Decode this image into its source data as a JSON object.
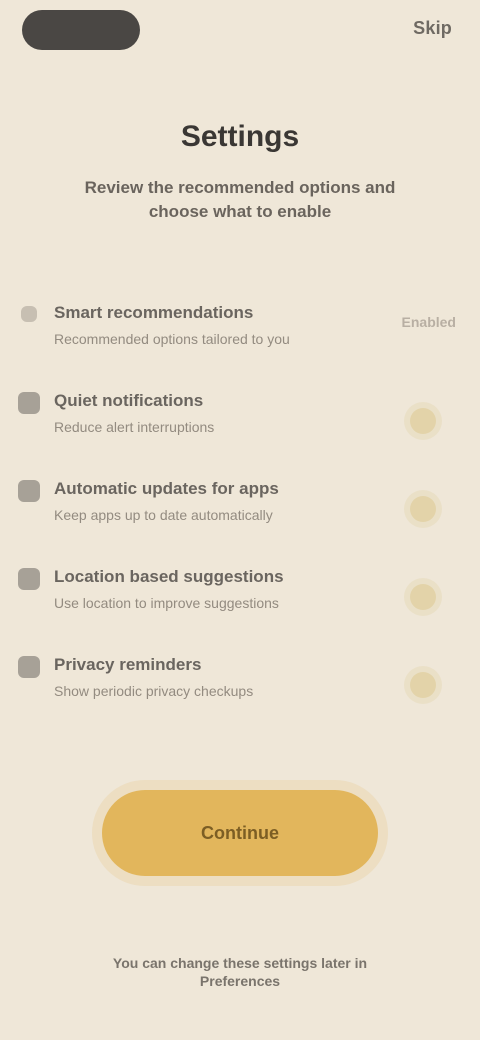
{
  "colors": {
    "background": "#efe7d8",
    "text_primary": "#3a3734",
    "text_secondary": "#6a645d",
    "accent": "#e2b65c",
    "toggle_fill": "#e3d3a9"
  },
  "top_bar": {
    "back_icon": "back-pill-icon",
    "skip_label": "Skip"
  },
  "header": {
    "title": "Settings",
    "subtitle": "Review the recommended options and choose what to enable"
  },
  "list": {
    "items": [
      {
        "title": "Smart recommendations",
        "description": "Recommended options tailored to you",
        "status": "Enabled",
        "control": "none"
      },
      {
        "title": "Quiet notifications",
        "description": "Reduce alert interruptions",
        "status": "",
        "control": "toggle"
      },
      {
        "title": "Automatic updates for apps",
        "description": "Keep apps up to date automatically",
        "status": "",
        "control": "toggle"
      },
      {
        "title": "Location based suggestions",
        "description": "Use location to improve suggestions",
        "status": "",
        "control": "toggle"
      },
      {
        "title": "Privacy reminders",
        "description": "Show periodic privacy checkups",
        "status": "",
        "control": "toggle"
      }
    ]
  },
  "cta": {
    "label": "Continue"
  },
  "footer": {
    "note": "You can change these settings later in Preferences"
  }
}
